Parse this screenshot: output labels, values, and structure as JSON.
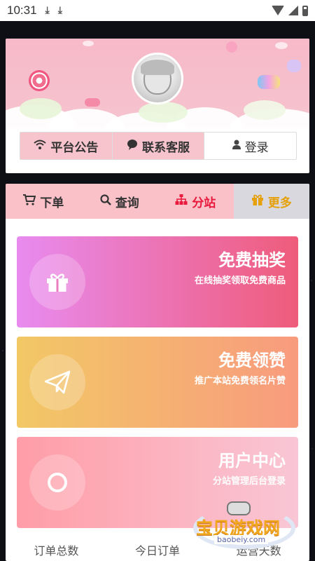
{
  "status_bar": {
    "time": "10:31",
    "download_glyph": "⤓"
  },
  "header": {
    "buttons": [
      {
        "label": "平台公告",
        "icon": "wifi-icon"
      },
      {
        "label": "联系客服",
        "icon": "chat-bubble-icon"
      },
      {
        "label": "登录",
        "icon": "user-icon"
      }
    ]
  },
  "tabs": [
    {
      "label": "下单",
      "icon": "cart-icon"
    },
    {
      "label": "查询",
      "icon": "search-icon"
    },
    {
      "label": "分站",
      "icon": "sitemap-icon"
    },
    {
      "label": "更多",
      "icon": "gift-icon"
    }
  ],
  "cards": [
    {
      "title": "免费抽奖",
      "subtitle": "在线抽奖领取免费商品",
      "icon": "gift-icon"
    },
    {
      "title": "免费领赞",
      "subtitle": "推广本站免费领名片赞",
      "icon": "paper-plane-icon"
    },
    {
      "title": "用户中心",
      "subtitle": "分站管理后台登录",
      "icon": "circle-icon"
    }
  ],
  "stats": {
    "labels": [
      "订单总数",
      "今日订单",
      "运营天数"
    ]
  },
  "watermark": {
    "text": "宝贝游戏网",
    "url": "baobeiy.com"
  },
  "colors": {
    "tab_active": "#e6a00a",
    "tab_red": "#e8193c",
    "banner": "#f7b9c8"
  }
}
